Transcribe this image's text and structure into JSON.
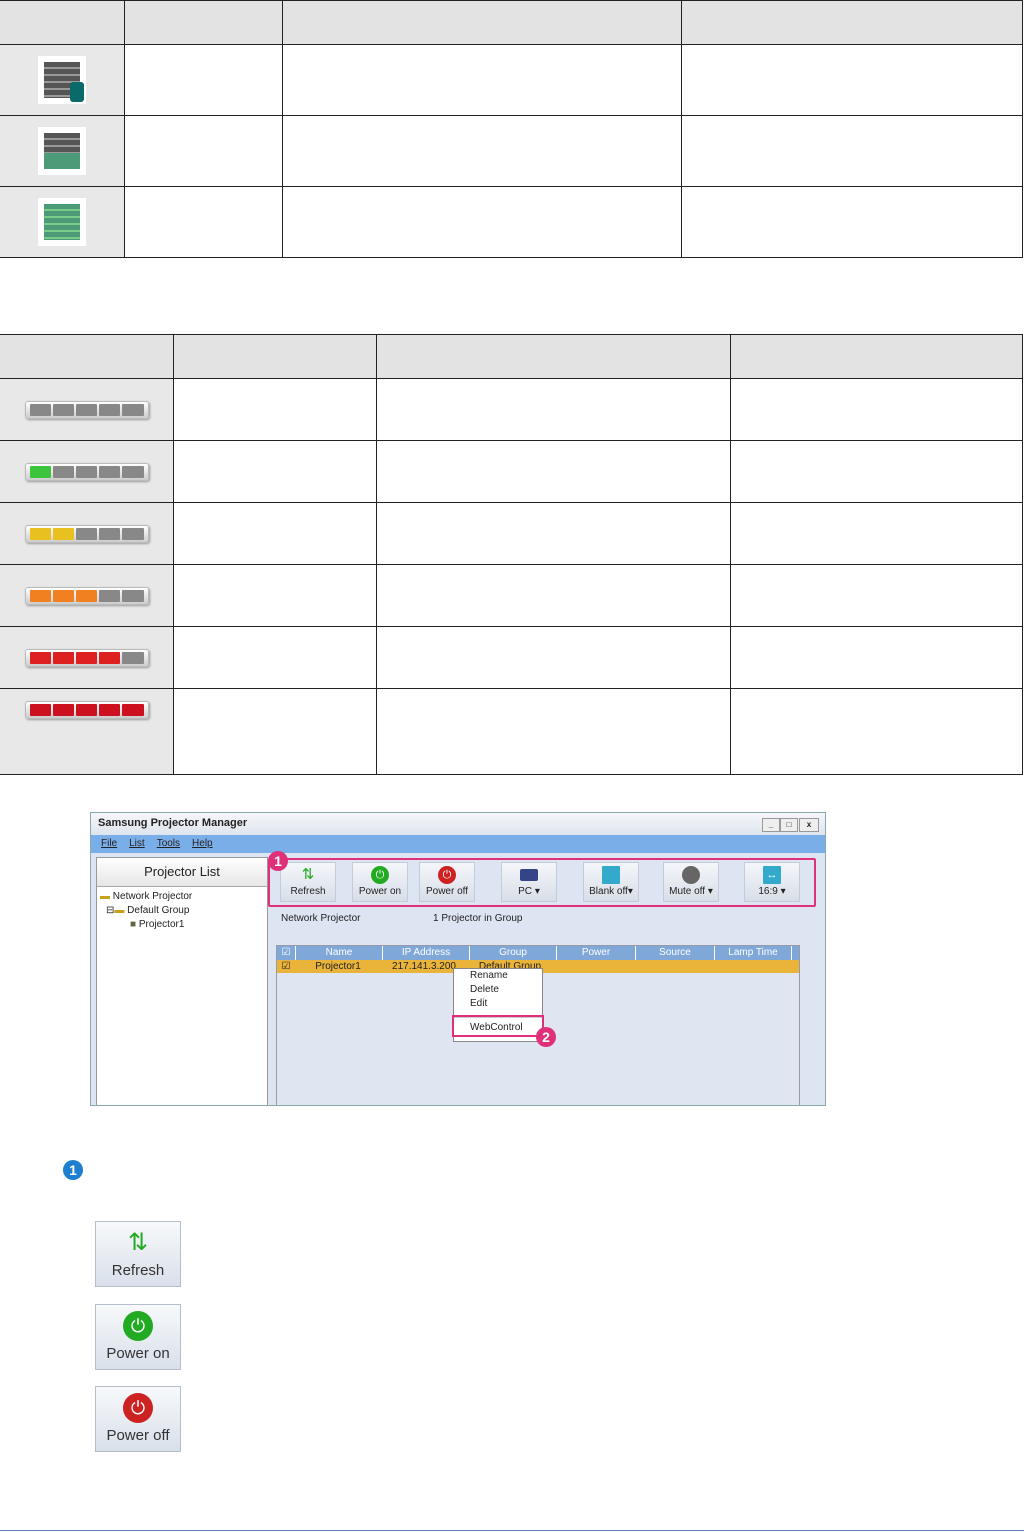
{
  "status_icons": [
    "list-loading-icon",
    "list-partial-network-icon",
    "list-full-network-icon"
  ],
  "lamp_levels": [
    {
      "lit": 0,
      "color": "#888888"
    },
    {
      "lit": 1,
      "color": "#3cc43c"
    },
    {
      "lit": 2,
      "color": "#e8c020"
    },
    {
      "lit": 3,
      "color": "#f08020"
    },
    {
      "lit": 4,
      "color": "#dd2020"
    },
    {
      "lit": 5,
      "color": "#cc1020"
    }
  ],
  "window": {
    "title": "Samsung Projector Manager",
    "controls": [
      "_",
      "□",
      "x"
    ],
    "menu": [
      "File",
      "List",
      "Tools",
      "Help"
    ],
    "sidebar": {
      "title": "Projector List",
      "tree": [
        "Network Projector",
        "Default Group",
        "Projector1"
      ]
    },
    "toolbar": [
      "Refresh",
      "Power on",
      "Power off",
      "PC",
      "Blank off",
      "Mute off",
      "16:9"
    ],
    "info": {
      "group": "Network Projector",
      "count": "1 Projector in Group"
    },
    "grid": {
      "columns": [
        "Name",
        "IP Address",
        "Group",
        "Power",
        "Source",
        "Lamp Time"
      ],
      "rows": [
        [
          "Projector1",
          "217.141.3.200",
          "Default Group",
          "",
          "",
          ""
        ]
      ]
    },
    "context_menu": [
      "Rename",
      "Delete",
      "Edit",
      "WebControl"
    ]
  },
  "callouts": [
    "1",
    "2"
  ],
  "buttons": [
    "Refresh",
    "Power on",
    "Power off"
  ],
  "colors": {
    "highlight": "#e0307a",
    "accent": "#1e7fd0"
  }
}
